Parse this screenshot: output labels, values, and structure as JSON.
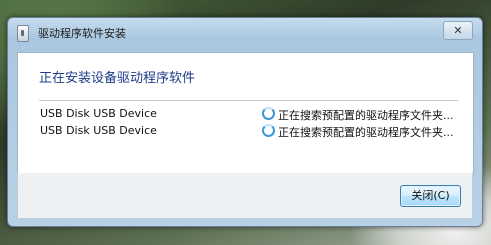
{
  "window": {
    "title": "驱动程序软件安装",
    "close_symbol": "✕"
  },
  "main": {
    "heading": "正在安装设备驱动程序软件",
    "devices": [
      {
        "name": "USB Disk USB Device",
        "status": "正在搜索预配置的驱动程序文件夹..."
      },
      {
        "name": "USB Disk USB Device",
        "status": "正在搜索预配置的驱动程序文件夹..."
      }
    ]
  },
  "footer": {
    "close_button_label": "关闭(C)"
  },
  "icons": {
    "title_icon": "device-install-icon",
    "status_icon": "busy-spinner-icon"
  },
  "colors": {
    "heading": "#1c3c88",
    "spinner": "#3a96d8",
    "frame": "#b9d1e6"
  }
}
